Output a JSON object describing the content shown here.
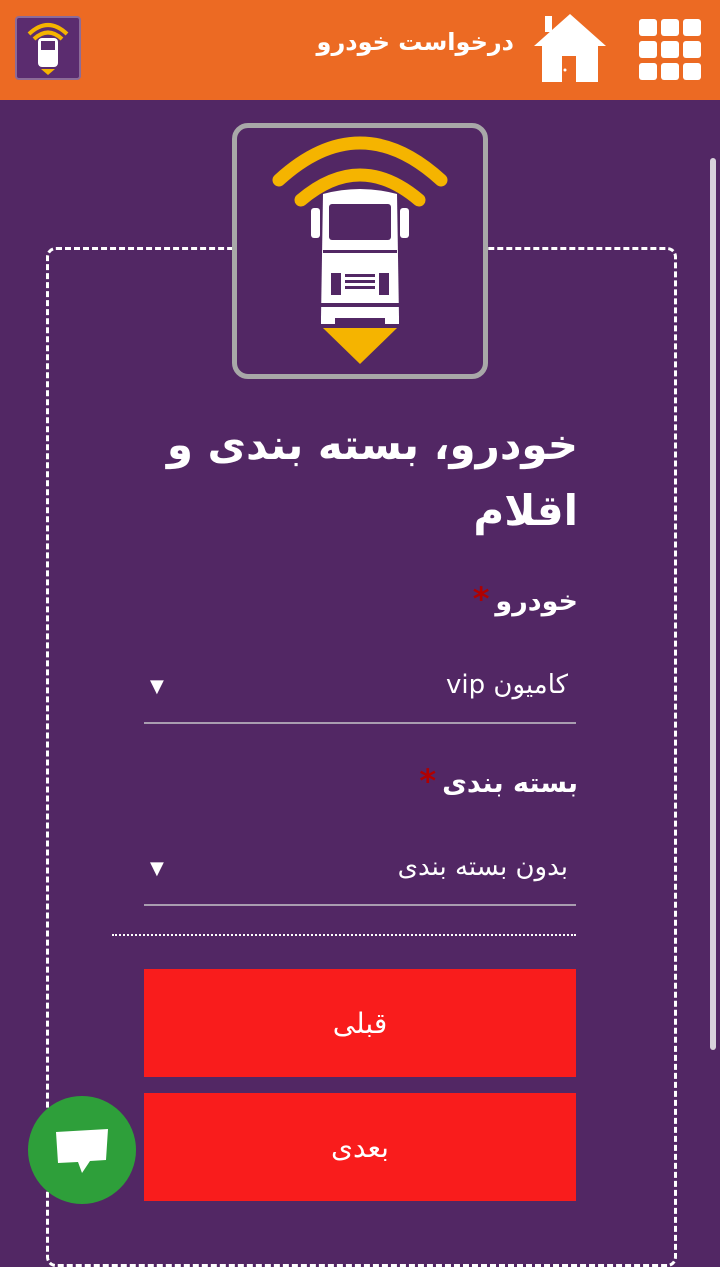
{
  "header": {
    "title": "درخواست خودرو",
    "bg_color": "#ec6a23",
    "icons": [
      "truck-logo-icon",
      "home-icon",
      "apps-grid-icon"
    ]
  },
  "form": {
    "title": "خودرو، بسته بندی و اقلام",
    "vehicle": {
      "label": "خودرو",
      "required_mark": "*",
      "selected": "کامیون vip",
      "arrow": "▼"
    },
    "packaging": {
      "label": "بسته بندی",
      "required_mark": "*",
      "selected": "بدون بسته بندی",
      "arrow": "▼"
    },
    "buttons": {
      "previous": "قبلی",
      "next": "بعدی"
    },
    "button_color": "#f91c1c"
  },
  "colors": {
    "background": "#522764",
    "accent_yellow": "#f5b400",
    "chat_fab": "#2e9f3a"
  },
  "fab": {
    "icon": "chat-bubble-icon"
  }
}
